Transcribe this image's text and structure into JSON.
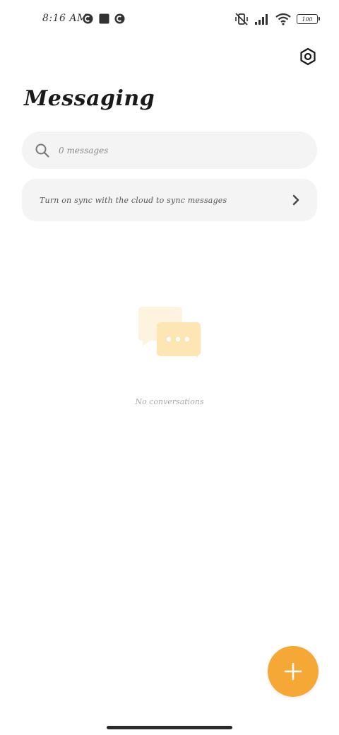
{
  "status_bar": {
    "time": "8:16 AM",
    "battery_level": "100",
    "icons": [
      "notification-c-icon",
      "notification-square-icon",
      "notification-c-icon",
      "vibrate-off-icon",
      "cellular-signal-icon",
      "wifi-icon",
      "battery-icon"
    ]
  },
  "header": {
    "title": "Messaging",
    "settings_icon": "settings-hexagon-icon"
  },
  "search": {
    "placeholder": "0 messages",
    "icon": "search-icon"
  },
  "sync_banner": {
    "text": "Turn on sync with the cloud to sync messages",
    "icon": "chevron-right-icon"
  },
  "empty_state": {
    "text": "No conversations",
    "icon": "chat-bubbles-icon"
  },
  "fab": {
    "icon": "plus-icon",
    "color": "#f6a837"
  },
  "colors": {
    "accent": "#f6a837",
    "surface": "#f4f4f4",
    "background": "#ffffff"
  }
}
